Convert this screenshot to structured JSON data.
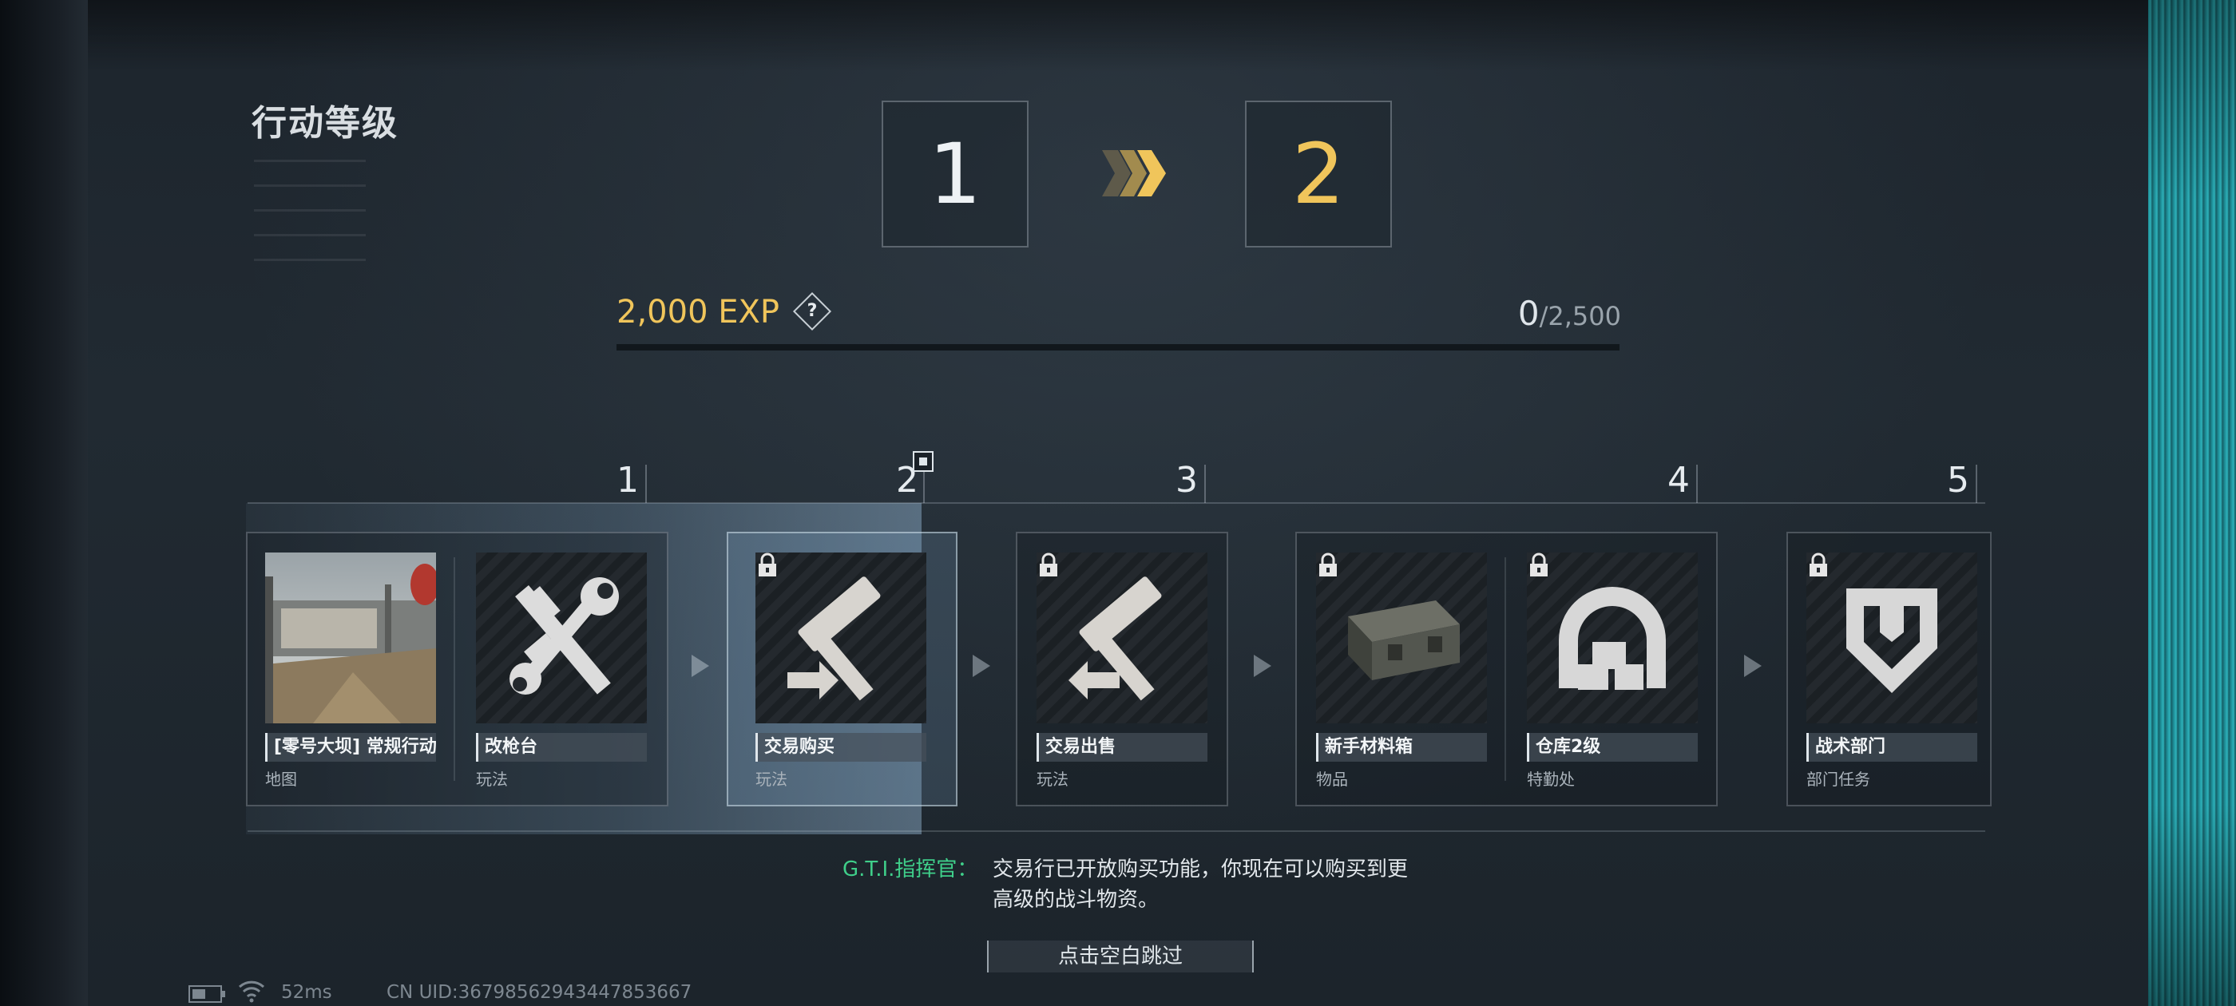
{
  "header": {
    "title": "行动等级"
  },
  "level": {
    "from": "1",
    "to": "2"
  },
  "exp": {
    "gain_label": "2,000 EXP",
    "help": "?",
    "current": "0",
    "separator": "/",
    "max": "2,500",
    "progress": 0.0
  },
  "milestones": [
    "1",
    "2",
    "3",
    "4",
    "5"
  ],
  "rewards": [
    {
      "name": "[零号大坝] 常规行动",
      "type": "地图",
      "locked": false,
      "icon": "map-photo"
    },
    {
      "name": "改枪台",
      "type": "玩法",
      "locked": false,
      "icon": "gun-wrench-icon"
    },
    {
      "name": "交易购买",
      "type": "玩法",
      "locked": true,
      "icon": "hammer-buy-icon"
    },
    {
      "name": "交易出售",
      "type": "玩法",
      "locked": true,
      "icon": "hammer-sell-icon"
    },
    {
      "name": "新手材料箱",
      "type": "物品",
      "locked": true,
      "icon": "crate-icon"
    },
    {
      "name": "仓库2级",
      "type": "特勤处",
      "locked": true,
      "icon": "warehouse-icon"
    },
    {
      "name": "战术部门",
      "type": "部门任务",
      "locked": true,
      "icon": "shield-icon"
    }
  ],
  "dialogue": {
    "speaker": "G.T.I.指挥官：",
    "message": "交易行已开放购买功能，你现在可以购买到更高级的战斗物资。"
  },
  "skip": {
    "label": "点击空白跳过"
  },
  "status": {
    "ping": "52ms",
    "uid": "CN UID:3679856294344785366​7"
  },
  "colors": {
    "accent_gold": "#f0c55b",
    "speaker_green": "#3fcf8a"
  }
}
